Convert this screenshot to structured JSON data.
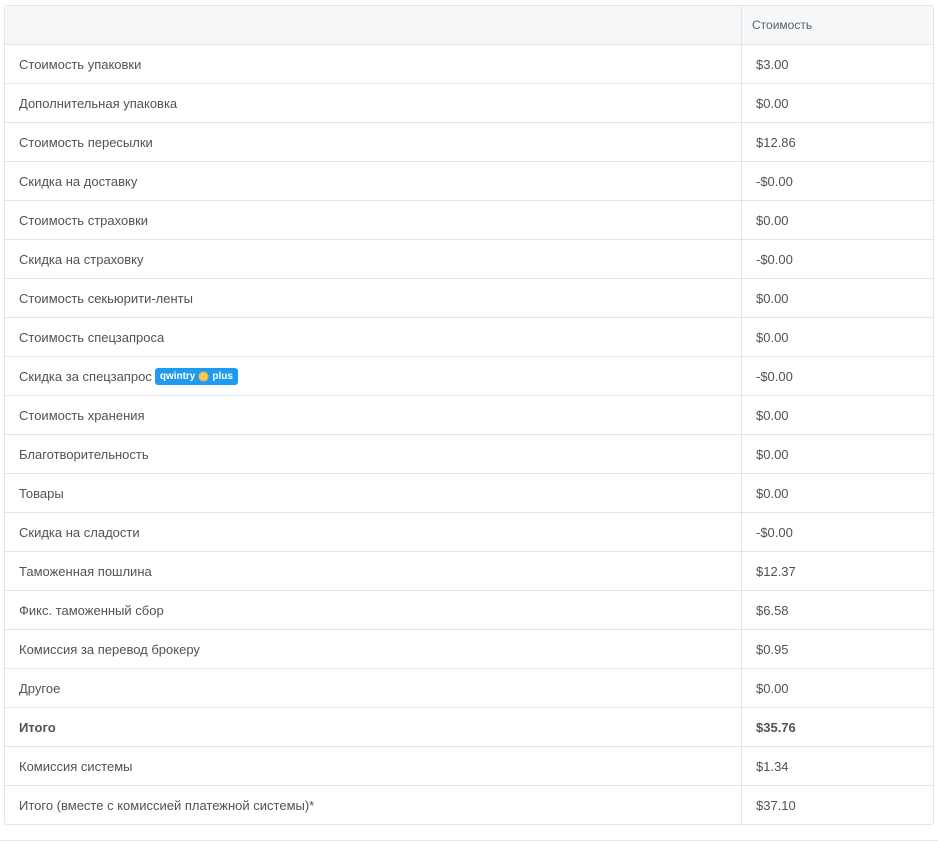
{
  "header": {
    "label_column": "",
    "value_column": "Стоимость"
  },
  "rows": [
    {
      "label": "Стоимость упаковки",
      "value": "$3.00"
    },
    {
      "label": "Дополнительная упаковка",
      "value": "$0.00"
    },
    {
      "label": "Стоимость пересылки",
      "value": "$12.86"
    },
    {
      "label": "Скидка на доставку",
      "value": "-$0.00"
    },
    {
      "label": "Стоимость страховки",
      "value": "$0.00"
    },
    {
      "label": "Скидка на страховку",
      "value": "-$0.00"
    },
    {
      "label": "Стоимость секьюрити-ленты",
      "value": "$0.00"
    },
    {
      "label": "Стоимость спецзапроса",
      "value": "$0.00"
    },
    {
      "label": "Скидка за спецзапрос",
      "value": "-$0.00",
      "badge": {
        "left": "qwintry",
        "right": "plus",
        "icon": "sun-icon"
      }
    },
    {
      "label": "Стоимость хранения",
      "value": "$0.00"
    },
    {
      "label": "Благотворительность",
      "value": "$0.00"
    },
    {
      "label": "Товары",
      "value": "$0.00"
    },
    {
      "label": "Скидка на сладости",
      "value": "-$0.00"
    },
    {
      "label": "Таможенная пошлина",
      "value": "$12.37"
    },
    {
      "label": "Фикс. таможенный сбор",
      "value": "$6.58"
    },
    {
      "label": "Комиссия за перевод брокеру",
      "value": "$0.95"
    },
    {
      "label": "Другое",
      "value": "$0.00"
    },
    {
      "label": "Итого",
      "value": "$35.76",
      "bold": true
    },
    {
      "label": "Комиссия системы",
      "value": "$1.34"
    },
    {
      "label": "Итого (вместе с комиссией платежной системы)*",
      "value": "$37.10"
    }
  ],
  "colors": {
    "text": "#4d5358",
    "border": "#e1e5e9",
    "header_bg": "#f6f7f8",
    "badge_bg": "#1e9bf0",
    "badge_icon": "#f5b93c"
  }
}
